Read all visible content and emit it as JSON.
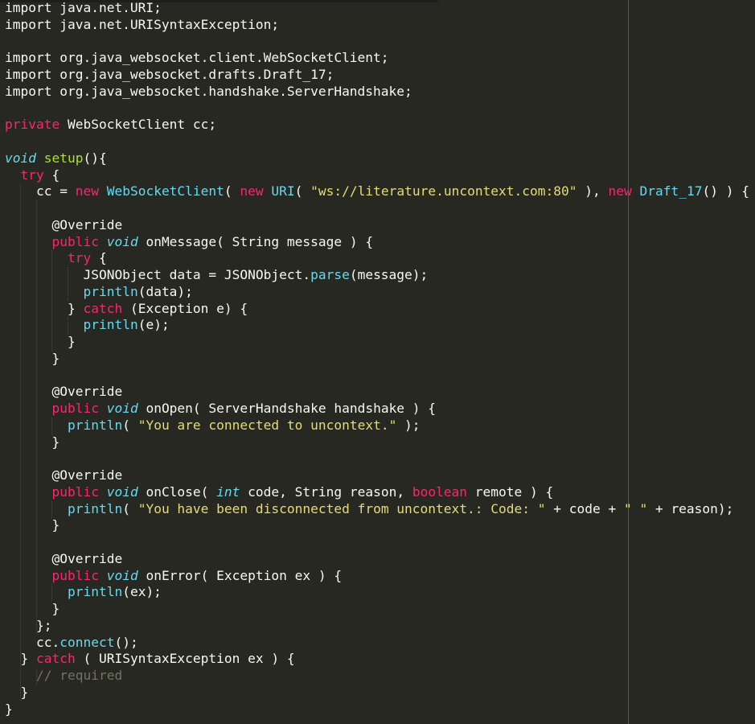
{
  "editor": {
    "theme": "monokai",
    "colors": {
      "background": "#272822",
      "foreground": "#f8f8f2",
      "keyword": "#f92672",
      "storage_type": "#66d9ef",
      "function": "#a6e22e",
      "class": "#66d9ef",
      "string": "#e6db74",
      "comment": "#75715e"
    },
    "lines": [
      [
        {
          "t": "p",
          "v": "import java.net.URI;"
        }
      ],
      [
        {
          "t": "p",
          "v": "import java.net.URISyntaxException;"
        }
      ],
      [],
      [
        {
          "t": "p",
          "v": "import org.java_websocket.client.WebSocketClient;"
        }
      ],
      [
        {
          "t": "p",
          "v": "import org.java_websocket.drafts.Draft_17;"
        }
      ],
      [
        {
          "t": "p",
          "v": "import org.java_websocket.handshake.ServerHandshake;"
        }
      ],
      [],
      [
        {
          "t": "k",
          "v": "private"
        },
        {
          "t": "p",
          "v": " WebSocketClient cc;"
        }
      ],
      [],
      [
        {
          "t": "t",
          "v": "void"
        },
        {
          "t": "p",
          "v": " "
        },
        {
          "t": "f",
          "v": "setup"
        },
        {
          "t": "p",
          "v": "(){"
        }
      ],
      [
        {
          "t": "p",
          "v": "  "
        },
        {
          "t": "k",
          "v": "try"
        },
        {
          "t": "p",
          "v": " {"
        }
      ],
      [
        {
          "t": "p",
          "v": "    cc = "
        },
        {
          "t": "k",
          "v": "new"
        },
        {
          "t": "p",
          "v": " "
        },
        {
          "t": "c",
          "v": "WebSocketClient"
        },
        {
          "t": "p",
          "v": "( "
        },
        {
          "t": "k",
          "v": "new"
        },
        {
          "t": "p",
          "v": " "
        },
        {
          "t": "c",
          "v": "URI"
        },
        {
          "t": "p",
          "v": "( "
        },
        {
          "t": "s",
          "v": "\"ws://literature.uncontext.com:80\""
        },
        {
          "t": "p",
          "v": " ), "
        },
        {
          "t": "k",
          "v": "new"
        },
        {
          "t": "p",
          "v": " "
        },
        {
          "t": "c",
          "v": "Draft_17"
        },
        {
          "t": "p",
          "v": "() ) {"
        }
      ],
      [],
      [
        {
          "t": "p",
          "v": "      @Override"
        }
      ],
      [
        {
          "t": "p",
          "v": "      "
        },
        {
          "t": "k",
          "v": "public"
        },
        {
          "t": "p",
          "v": " "
        },
        {
          "t": "t",
          "v": "void"
        },
        {
          "t": "p",
          "v": " onMessage( String message ) {"
        }
      ],
      [
        {
          "t": "p",
          "v": "        "
        },
        {
          "t": "k",
          "v": "try"
        },
        {
          "t": "p",
          "v": " {"
        }
      ],
      [
        {
          "t": "p",
          "v": "          JSONObject data = JSONObject."
        },
        {
          "t": "c",
          "v": "parse"
        },
        {
          "t": "p",
          "v": "(message);"
        }
      ],
      [
        {
          "t": "p",
          "v": "          "
        },
        {
          "t": "c",
          "v": "println"
        },
        {
          "t": "p",
          "v": "(data);"
        }
      ],
      [
        {
          "t": "p",
          "v": "        } "
        },
        {
          "t": "k",
          "v": "catch"
        },
        {
          "t": "p",
          "v": " (Exception e) {"
        }
      ],
      [
        {
          "t": "p",
          "v": "          "
        },
        {
          "t": "c",
          "v": "println"
        },
        {
          "t": "p",
          "v": "(e);"
        }
      ],
      [
        {
          "t": "p",
          "v": "        }"
        }
      ],
      [
        {
          "t": "p",
          "v": "      }"
        }
      ],
      [],
      [
        {
          "t": "p",
          "v": "      @Override"
        }
      ],
      [
        {
          "t": "p",
          "v": "      "
        },
        {
          "t": "k",
          "v": "public"
        },
        {
          "t": "p",
          "v": " "
        },
        {
          "t": "t",
          "v": "void"
        },
        {
          "t": "p",
          "v": " onOpen( ServerHandshake handshake ) {"
        }
      ],
      [
        {
          "t": "p",
          "v": "        "
        },
        {
          "t": "c",
          "v": "println"
        },
        {
          "t": "p",
          "v": "( "
        },
        {
          "t": "s",
          "v": "\"You are connected to uncontext.\""
        },
        {
          "t": "p",
          "v": " );"
        }
      ],
      [
        {
          "t": "p",
          "v": "      }"
        }
      ],
      [],
      [
        {
          "t": "p",
          "v": "      @Override"
        }
      ],
      [
        {
          "t": "p",
          "v": "      "
        },
        {
          "t": "k",
          "v": "public"
        },
        {
          "t": "p",
          "v": " "
        },
        {
          "t": "t",
          "v": "void"
        },
        {
          "t": "p",
          "v": " onClose( "
        },
        {
          "t": "t",
          "v": "int"
        },
        {
          "t": "p",
          "v": " code, String reason, "
        },
        {
          "t": "k",
          "v": "boolean"
        },
        {
          "t": "p",
          "v": " remote ) {"
        }
      ],
      [
        {
          "t": "p",
          "v": "        "
        },
        {
          "t": "c",
          "v": "println"
        },
        {
          "t": "p",
          "v": "( "
        },
        {
          "t": "s",
          "v": "\"You have been disconnected from uncontext.: Code: \""
        },
        {
          "t": "p",
          "v": " + code + "
        },
        {
          "t": "s",
          "v": "\" \""
        },
        {
          "t": "p",
          "v": " + reason);"
        }
      ],
      [
        {
          "t": "p",
          "v": "      }"
        }
      ],
      [],
      [
        {
          "t": "p",
          "v": "      @Override"
        }
      ],
      [
        {
          "t": "p",
          "v": "      "
        },
        {
          "t": "k",
          "v": "public"
        },
        {
          "t": "p",
          "v": " "
        },
        {
          "t": "t",
          "v": "void"
        },
        {
          "t": "p",
          "v": " onError( Exception ex ) {"
        }
      ],
      [
        {
          "t": "p",
          "v": "        "
        },
        {
          "t": "c",
          "v": "println"
        },
        {
          "t": "p",
          "v": "(ex);"
        }
      ],
      [
        {
          "t": "p",
          "v": "      }"
        }
      ],
      [
        {
          "t": "p",
          "v": "    };"
        }
      ],
      [
        {
          "t": "p",
          "v": "    cc."
        },
        {
          "t": "c",
          "v": "connect"
        },
        {
          "t": "p",
          "v": "();"
        }
      ],
      [
        {
          "t": "p",
          "v": "  } "
        },
        {
          "t": "k",
          "v": "catch"
        },
        {
          "t": "p",
          "v": " ( URISyntaxException ex ) {"
        }
      ],
      [
        {
          "t": "p",
          "v": "    "
        },
        {
          "t": "cm",
          "v": "// required"
        }
      ],
      [
        {
          "t": "p",
          "v": "  }"
        }
      ],
      [
        {
          "t": "p",
          "v": "}"
        }
      ]
    ]
  }
}
